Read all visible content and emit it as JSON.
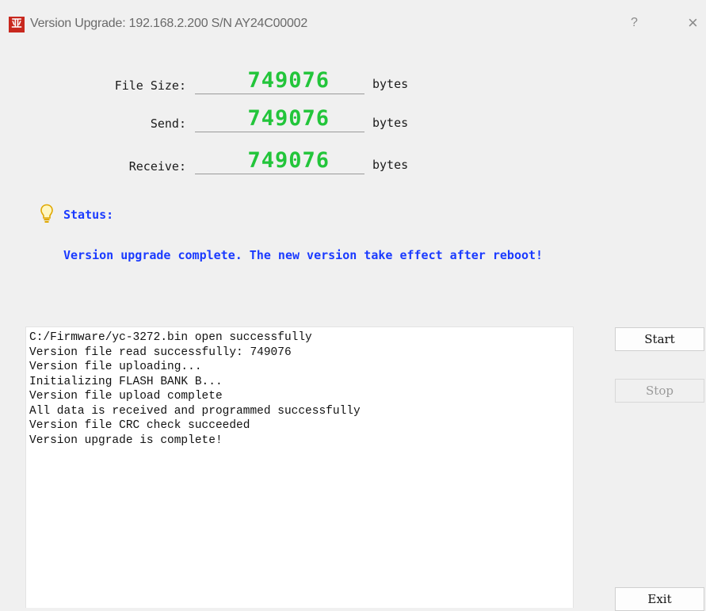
{
  "window": {
    "icon_text": "亚",
    "title": "Version Upgrade: 192.168.2.200  S/N AY24C00002",
    "help": "?",
    "close": "×"
  },
  "fields": [
    {
      "label": "File Size:",
      "value": "749076",
      "unit": "bytes"
    },
    {
      "label": "Send:",
      "value": "749076",
      "unit": "bytes"
    },
    {
      "label": "Receive:",
      "value": "749076",
      "unit": "bytes"
    }
  ],
  "status": {
    "label": "Status:",
    "message": "Version upgrade complete. The new version take effect after reboot!"
  },
  "log": [
    "C:/Firmware/yc-3272.bin open successfully",
    "Version file read successfully: 749076",
    "Version file uploading...",
    "Initializing FLASH BANK B...",
    "Version file upload complete",
    "All data is received and programmed successfully",
    "Version file CRC check succeeded",
    "Version upgrade is complete!"
  ],
  "buttons": {
    "start": "Start",
    "stop": "Stop",
    "exit": "Exit"
  },
  "colors": {
    "lcd_digits": "#22c53a",
    "status_text": "#1a3aff",
    "app_icon": "#c8281e"
  },
  "icons": {
    "status": "lightbulb-icon"
  }
}
